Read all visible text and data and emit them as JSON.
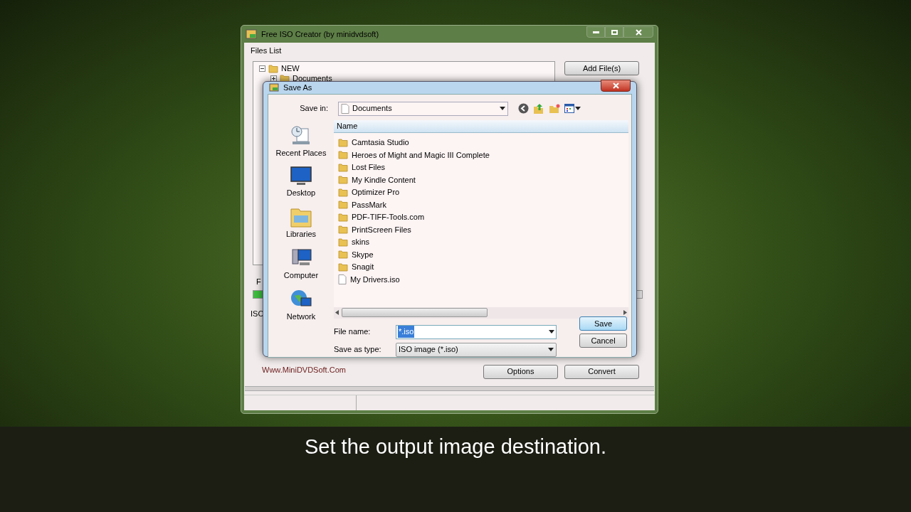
{
  "main_window": {
    "title": "Free ISO Creator (by minidvdsoft)",
    "files_list_label": "Files List",
    "tree": [
      {
        "label": "NEW",
        "expanded": true,
        "children": [
          {
            "label": "Documents",
            "expanded": false
          }
        ]
      }
    ],
    "add_button": "Add File(s)",
    "label_1": "F",
    "progress": {
      "level": 0.05
    },
    "label_2": "ISO",
    "link": "Www.MiniDVDSoft.Com",
    "buttons": [
      "Options",
      "Convert"
    ]
  },
  "dialog": {
    "title": "Save As",
    "save_in_label": "Save in:",
    "save_in_value": "Documents",
    "places": [
      {
        "label": "Recent Places",
        "kind": "recent"
      },
      {
        "label": "Desktop",
        "kind": "desktop"
      },
      {
        "label": "Libraries",
        "kind": "libraries"
      },
      {
        "label": "Computer",
        "kind": "computer"
      },
      {
        "label": "Network",
        "kind": "network"
      }
    ],
    "column": "Name",
    "files": [
      {
        "name": "Camtasia Studio",
        "kind": "folder"
      },
      {
        "name": "Heroes of Might and Magic III Complete",
        "kind": "folder"
      },
      {
        "name": "Lost Files",
        "kind": "folder"
      },
      {
        "name": "My Kindle Content",
        "kind": "folder"
      },
      {
        "name": "Optimizer Pro",
        "kind": "folder"
      },
      {
        "name": "PassMark",
        "kind": "folder"
      },
      {
        "name": "PDF-TIFF-Tools.com",
        "kind": "folder"
      },
      {
        "name": "PrintScreen Files",
        "kind": "folder"
      },
      {
        "name": "skins",
        "kind": "folder"
      },
      {
        "name": "Skype",
        "kind": "folder"
      },
      {
        "name": "Snagit",
        "kind": "folder"
      },
      {
        "name": "My Drivers.iso",
        "kind": "file"
      }
    ],
    "file_name_label": "File name:",
    "file_name_value": "*.iso",
    "file_type_label": "Save as type:",
    "file_type_value": "ISO image (*.iso)",
    "buttons": [
      {
        "label": "Save",
        "default": true
      },
      {
        "label": "Cancel",
        "default": false
      }
    ]
  },
  "caption": "Set the output image destination."
}
